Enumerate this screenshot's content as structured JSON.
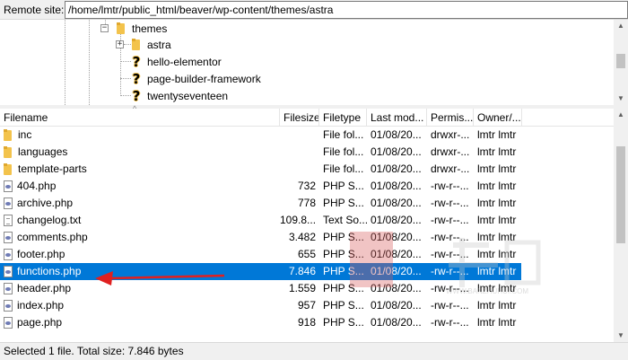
{
  "remote_site": {
    "label": "Remote site:",
    "path": "/home/lmtr/public_html/beaver/wp-content/themes/astra"
  },
  "tree": {
    "items": [
      {
        "label": "themes",
        "icon": "folder-icon",
        "expander": "−"
      },
      {
        "label": "astra",
        "icon": "folder-icon",
        "expander": "+"
      },
      {
        "label": "hello-elementor",
        "icon": "question-folder-icon"
      },
      {
        "label": "page-builder-framework",
        "icon": "question-folder-icon"
      },
      {
        "label": "twentyseventeen",
        "icon": "question-folder-icon"
      }
    ]
  },
  "list": {
    "columns": [
      "Filename",
      "Filesize",
      "Filetype",
      "Last mod...",
      "Permis...",
      "Owner/..."
    ],
    "rows": [
      {
        "name": "inc",
        "icon": "folder",
        "size": "",
        "type": "File fol...",
        "modified": "01/08/20...",
        "perms": "drwxr-...",
        "owner": "lmtr lmtr"
      },
      {
        "name": "languages",
        "icon": "folder",
        "size": "",
        "type": "File fol...",
        "modified": "01/08/20...",
        "perms": "drwxr-...",
        "owner": "lmtr lmtr"
      },
      {
        "name": "template-parts",
        "icon": "folder",
        "size": "",
        "type": "File fol...",
        "modified": "01/08/20...",
        "perms": "drwxr-...",
        "owner": "lmtr lmtr"
      },
      {
        "name": "404.php",
        "icon": "php",
        "size": "732",
        "type": "PHP S...",
        "modified": "01/08/20...",
        "perms": "-rw-r--...",
        "owner": "lmtr lmtr"
      },
      {
        "name": "archive.php",
        "icon": "php",
        "size": "778",
        "type": "PHP S...",
        "modified": "01/08/20...",
        "perms": "-rw-r--...",
        "owner": "lmtr lmtr"
      },
      {
        "name": "changelog.txt",
        "icon": "txt",
        "size": "109.8...",
        "type": "Text So...",
        "modified": "01/08/20...",
        "perms": "-rw-r--...",
        "owner": "lmtr lmtr"
      },
      {
        "name": "comments.php",
        "icon": "php",
        "size": "3.482",
        "type": "PHP S...",
        "modified": "01/08/20...",
        "perms": "-rw-r--...",
        "owner": "lmtr lmtr"
      },
      {
        "name": "footer.php",
        "icon": "php",
        "size": "655",
        "type": "PHP S...",
        "modified": "01/08/20...",
        "perms": "-rw-r--...",
        "owner": "lmtr lmtr"
      },
      {
        "name": "functions.php",
        "icon": "php",
        "size": "7.846",
        "type": "PHP S...",
        "modified": "01/08/20...",
        "perms": "-rw-r--...",
        "owner": "lmtr lmtr",
        "selected": true
      },
      {
        "name": "header.php",
        "icon": "php",
        "size": "1.559",
        "type": "PHP S...",
        "modified": "01/08/20...",
        "perms": "-rw-r--...",
        "owner": "lmtr lmtr"
      },
      {
        "name": "index.php",
        "icon": "php",
        "size": "957",
        "type": "PHP S...",
        "modified": "01/08/20...",
        "perms": "-rw-r--...",
        "owner": "lmtr lmtr"
      },
      {
        "name": "page.php",
        "icon": "php",
        "size": "918",
        "type": "PHP S...",
        "modified": "01/08/20...",
        "perms": "-rw-r--...",
        "owner": "lmtr lmtr"
      }
    ]
  },
  "status": {
    "text": "Selected 1 file. Total size: 7.846 bytes"
  },
  "colors": {
    "selection": "#0078d7",
    "annotation_arrow": "#e02020",
    "folder": "#f3c34c"
  },
  "watermark": {
    "text": "WWW.BANZHUHUI.COM"
  }
}
